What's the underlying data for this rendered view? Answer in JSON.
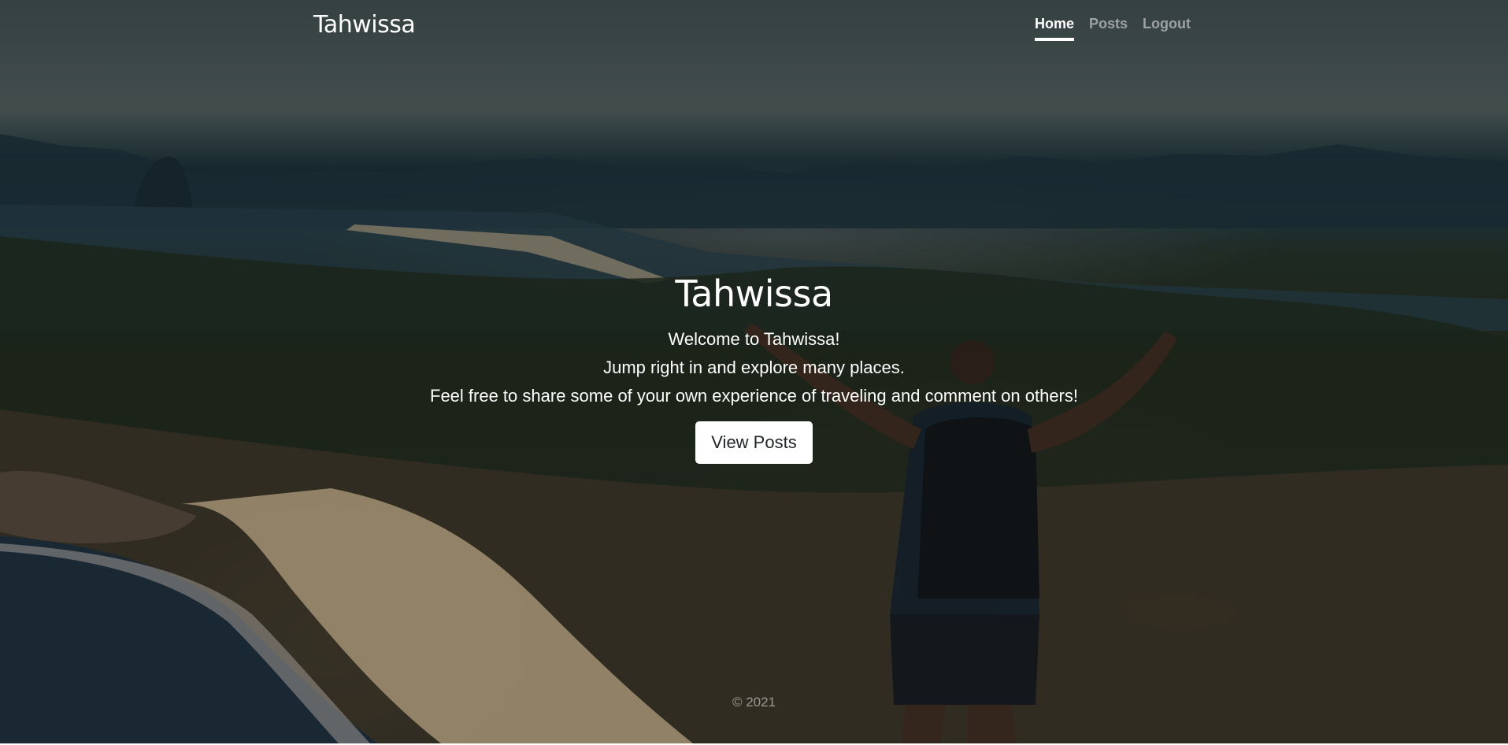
{
  "navbar": {
    "brand": "Tahwissa",
    "links": [
      {
        "label": "Home",
        "active": true
      },
      {
        "label": "Posts",
        "active": false
      },
      {
        "label": "Logout",
        "active": false
      }
    ]
  },
  "cover": {
    "heading": "Tahwissa",
    "lines": [
      "Welcome to Tahwissa!",
      "Jump right in and explore many places.",
      "Feel free to share some of your own experience of traveling and comment on others!"
    ],
    "button_label": "View Posts"
  },
  "footer": {
    "text": "© 2021"
  },
  "colors": {
    "text": "#ffffff",
    "muted_nav": "rgba(255,255,255,0.5)",
    "button_bg": "#ffffff",
    "button_text": "#212529"
  }
}
